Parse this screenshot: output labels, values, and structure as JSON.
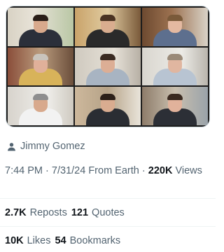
{
  "media": {
    "tiles": [
      {
        "id": "participant-1",
        "shirt": "#2b2f3a",
        "skin": "#d8a98c",
        "hair": "#2a1e18"
      },
      {
        "id": "participant-2",
        "shirt": "#2a2a2a",
        "skin": "#d9ad8f",
        "hair": "#4a3322"
      },
      {
        "id": "participant-3",
        "shirt": "#5d6f8e",
        "skin": "#e4b9a1",
        "hair": "#7a5a3a"
      },
      {
        "id": "participant-4",
        "shirt": "#d8b35a",
        "skin": "#e0b09a",
        "hair": "#c9c4bc"
      },
      {
        "id": "participant-5",
        "shirt": "#a8b4c2",
        "skin": "#dcae95",
        "hair": "#3b2b22"
      },
      {
        "id": "participant-6",
        "shirt": "#b8c4d2",
        "skin": "#e0b6a0",
        "hair": "#9a8a78"
      },
      {
        "id": "participant-7",
        "shirt": "#f2f2f2",
        "skin": "#d8a98c",
        "hair": "#8e8e8e"
      },
      {
        "id": "participant-8",
        "shirt": "#2a2d33",
        "skin": "#d9ac90",
        "hair": "#2c2019"
      },
      {
        "id": "participant-9",
        "shirt": "#2c2f36",
        "skin": "#e1b29b",
        "hair": "#3a2a20"
      }
    ]
  },
  "author": {
    "name": "Jimmy Gomez",
    "icon": "person-icon"
  },
  "meta": {
    "time": "7:44 PM",
    "separator": "·",
    "date": "7/31/24",
    "source": "From Earth",
    "views_count": "220K",
    "views_label": "Views"
  },
  "stats": {
    "reposts_count": "2.7K",
    "reposts_label": "Reposts",
    "quotes_count": "121",
    "quotes_label": "Quotes",
    "likes_count": "10K",
    "likes_label": "Likes",
    "bookmarks_count": "54",
    "bookmarks_label": "Bookmarks"
  },
  "colors": {
    "text_primary": "#0f1419",
    "text_secondary": "#536471",
    "divider": "#eff3f4"
  }
}
